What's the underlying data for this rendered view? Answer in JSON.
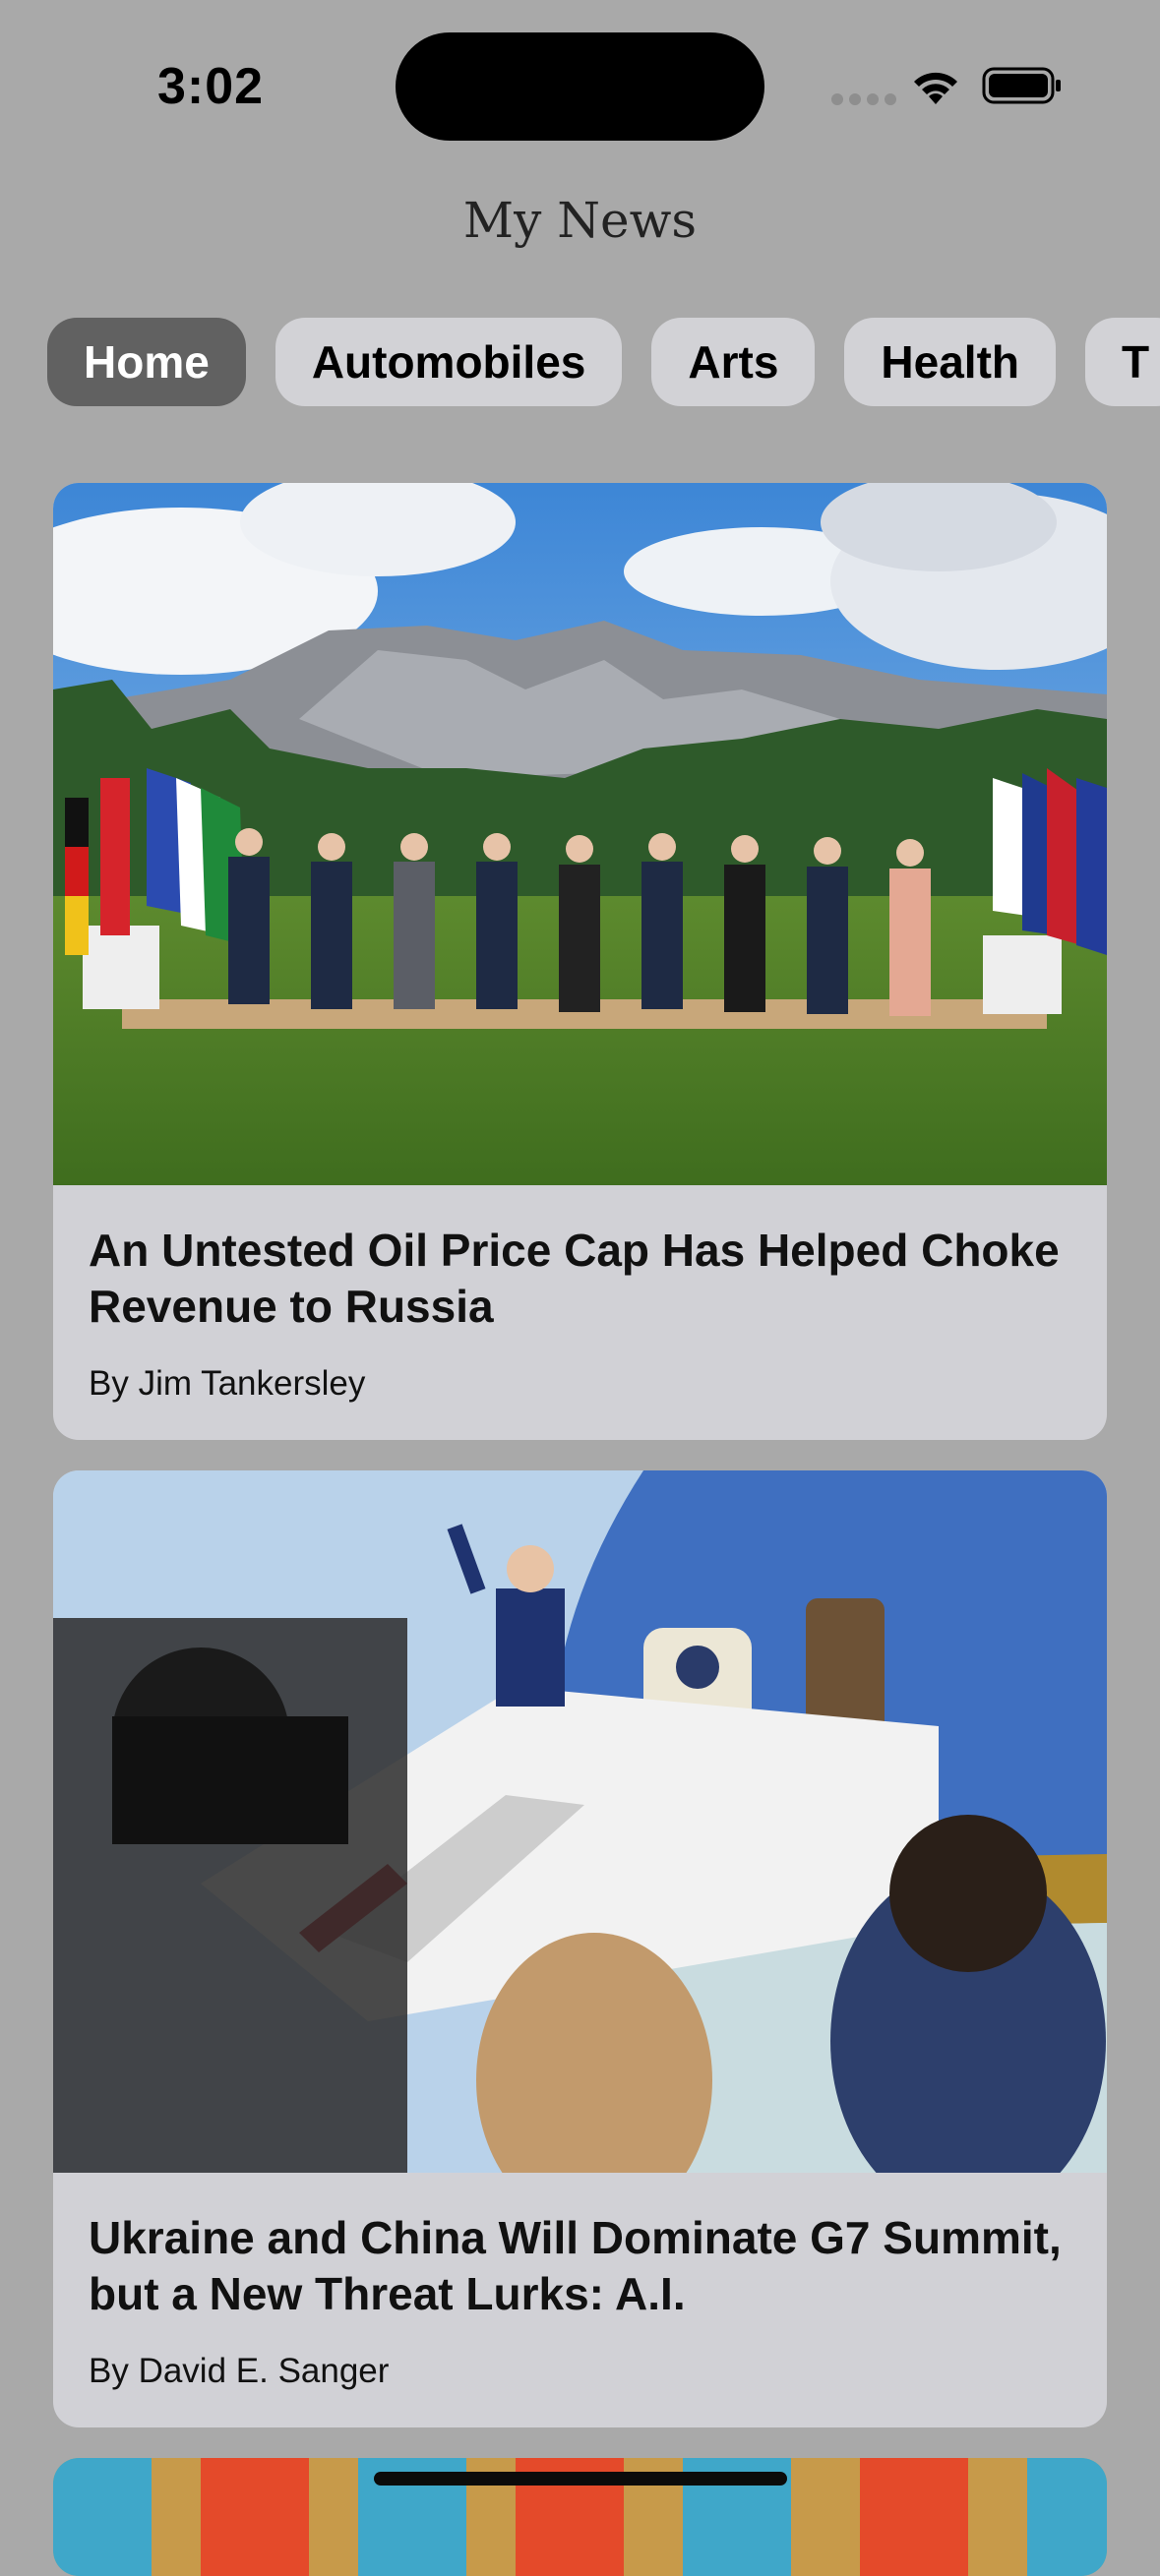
{
  "status_bar": {
    "time": "3:02"
  },
  "app": {
    "title": "My News"
  },
  "tabs": [
    {
      "label": "Home",
      "active": true
    },
    {
      "label": "Automobiles",
      "active": false
    },
    {
      "label": "Arts",
      "active": false
    },
    {
      "label": "Health",
      "active": false
    },
    {
      "label": "T",
      "active": false
    }
  ],
  "articles": [
    {
      "headline": "An Untested Oil Price Cap Has Helped Choke Revenue to Russia",
      "byline": "By Jim Tankersley"
    },
    {
      "headline": "Ukraine and China Will Dominate G7 Summit, but a New Threat Lurks: A.I.",
      "byline": "By David E. Sanger"
    }
  ],
  "colors": {
    "background": "#a9a9a9",
    "card": "#d1d1d6",
    "tab_active": "#616161",
    "tab_inactive": "#d2d2d6"
  }
}
